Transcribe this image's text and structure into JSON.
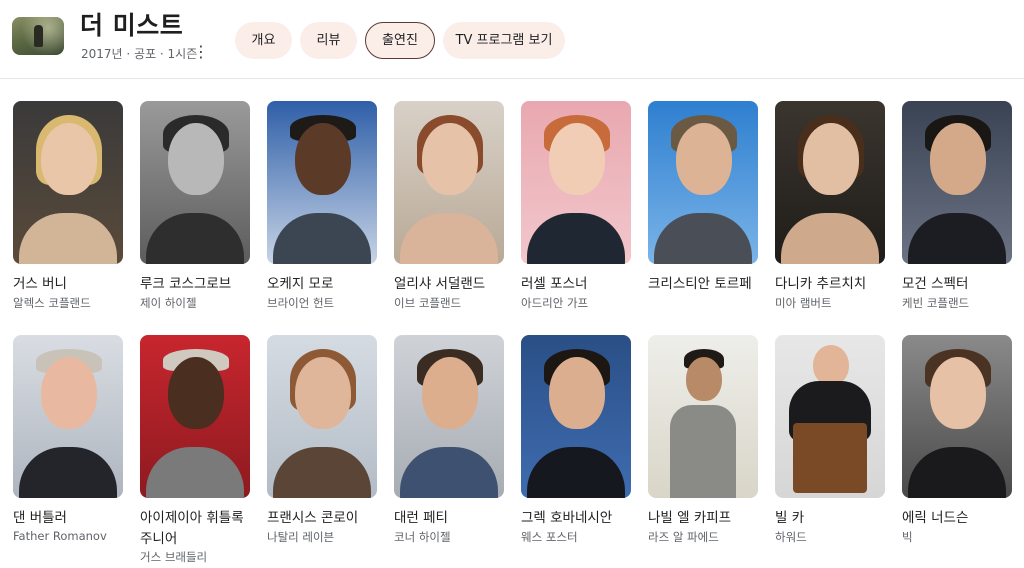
{
  "show": {
    "title": "더 미스트",
    "subtitle": "2017년 · 공포 · 1시즌",
    "more_icon": "⋮"
  },
  "tabs": [
    {
      "label": "개요",
      "active": false
    },
    {
      "label": "리뷰",
      "active": false
    },
    {
      "label": "출연진",
      "active": true
    },
    {
      "label": "TV 프로그램 보기",
      "active": false
    }
  ],
  "cast": [
    {
      "name": "거스 버니",
      "role": "알렉스 코플랜드"
    },
    {
      "name": "루크 코스그로브",
      "role": "제이 하이젤"
    },
    {
      "name": "오케지 모로",
      "role": "브라이언 헌트"
    },
    {
      "name": "얼리샤 서덜랜드",
      "role": "이브 코플랜드"
    },
    {
      "name": "러셀 포스너",
      "role": "아드리안 가프"
    },
    {
      "name": "크리스티안 토르페",
      "role": ""
    },
    {
      "name": "다니카 추르치치",
      "role": "미아 램버트"
    },
    {
      "name": "모건 스펙터",
      "role": "케빈 코플랜드"
    },
    {
      "name": "댄 버틀러",
      "role": "Father Romanov"
    },
    {
      "name": "아이제이아 휘틀록",
      "name2": "주니어",
      "role": "거스 브래들리"
    },
    {
      "name": "프랜시스 콘로이",
      "role": "나탈리 레이븐"
    },
    {
      "name": "대런 페티",
      "role": "코너 하이젤"
    },
    {
      "name": "그렉 호바네시안",
      "role": "웨스 포스터"
    },
    {
      "name": "나빌 엘 카피프",
      "role": "라즈 알 파에드"
    },
    {
      "name": "빌 카",
      "role": "하워드"
    },
    {
      "name": "에릭 너드슨",
      "role": "빅"
    }
  ]
}
